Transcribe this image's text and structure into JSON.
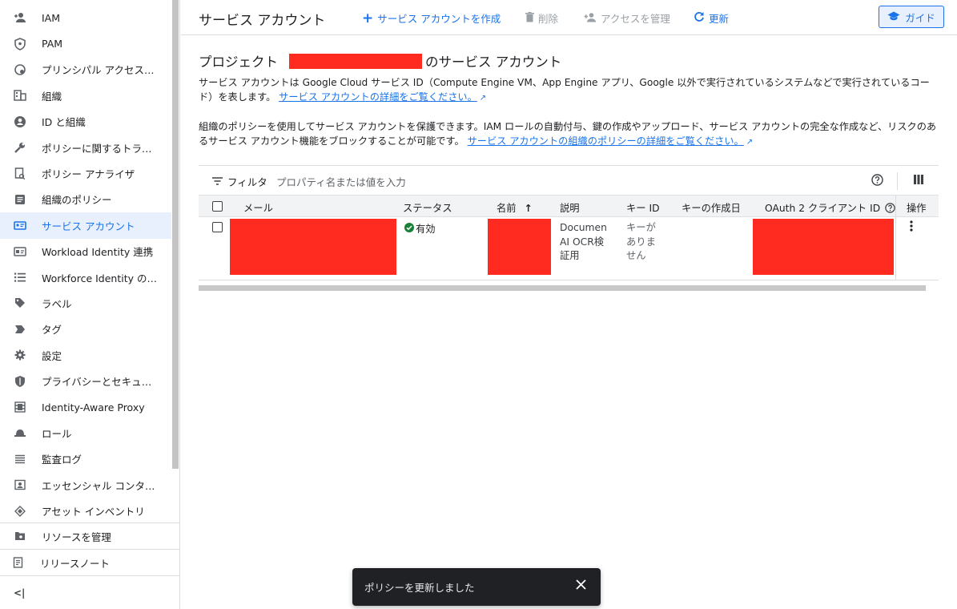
{
  "sidebar": {
    "items": [
      {
        "label": "IAM",
        "icon": "person-add-icon"
      },
      {
        "label": "PAM",
        "icon": "shield-icon"
      },
      {
        "label": "プリンシパル アクセス…",
        "icon": "principal-access-icon"
      },
      {
        "label": "組織",
        "icon": "building-icon"
      },
      {
        "label": "ID と組織",
        "icon": "account-circle-icon"
      },
      {
        "label": "ポリシーに関するトラ…",
        "icon": "wrench-icon"
      },
      {
        "label": "ポリシー アナライザ",
        "icon": "policy-analyzer-icon"
      },
      {
        "label": "組織のポリシー",
        "icon": "document-icon"
      },
      {
        "label": "サービス アカウント",
        "icon": "service-account-icon",
        "active": true
      },
      {
        "label": "Workload Identity 連携",
        "icon": "id-card-icon"
      },
      {
        "label": "Workforce Identity の連…",
        "icon": "list-icon"
      },
      {
        "label": "ラベル",
        "icon": "label-icon"
      },
      {
        "label": "タグ",
        "icon": "tag-icon"
      },
      {
        "label": "設定",
        "icon": "gear-icon"
      },
      {
        "label": "プライバシーとセキュ…",
        "icon": "privacy-shield-icon"
      },
      {
        "label": "Identity-Aware Proxy",
        "icon": "proxy-icon"
      },
      {
        "label": "ロール",
        "icon": "role-hat-icon"
      },
      {
        "label": "監査ログ",
        "icon": "lines-icon"
      },
      {
        "label": "エッセンシャル コンタ…",
        "icon": "contact-card-icon"
      },
      {
        "label": "アセット インベントリ",
        "icon": "inventory-icon"
      }
    ],
    "manage_resources": "リソースを管理",
    "release_notes": "リリースノート",
    "collapse_glyph": "<|"
  },
  "header": {
    "title": "サービス アカウント",
    "create_label": "サービス アカウントを作成",
    "delete_label": "削除",
    "manage_access_label": "アクセスを管理",
    "refresh_label": "更新",
    "guide_label": "ガイド"
  },
  "content": {
    "section_title_prefix": "プロジェクト",
    "section_title_suffix": "のサービス アカウント",
    "para1_text": "サービス アカウントは Google Cloud サービス ID（Compute Engine VM、App Engine アプリ、Google 以外で実行されているシステムなどで実行されているコード）を表します。",
    "para1_link": "サービス アカウントの詳細をご覧ください。",
    "para2_text": "組織のポリシーを使用してサービス アカウントを保護できます。IAM ロールの自動付与、鍵の作成やアップロード、サービス アカウントの完全な作成など、リスクのあるサービス アカウント機能をブロックすることが可能です。",
    "para2_link": "サービス アカウントの組織のポリシーの詳細をご覧ください。"
  },
  "filter": {
    "label": "フィルタ",
    "placeholder": "プロパティ名または値を入力"
  },
  "table": {
    "columns": {
      "email": "メール",
      "status": "ステータス",
      "name": "名前",
      "description": "説明",
      "key_id": "キー ID",
      "key_created": "キーの作成日",
      "oauth_client_id": "OAuth 2 クライアント ID",
      "actions": "操作"
    },
    "rows": [
      {
        "status": "有効",
        "description_lines": [
          "Documen",
          "AI OCR検",
          "証用"
        ],
        "key_id_lines": [
          "キーが",
          "ありま",
          "せん"
        ]
      }
    ]
  },
  "snackbar": {
    "message": "ポリシーを更新しました"
  },
  "colors": {
    "accent": "#1a73e8",
    "active_bg": "#e8f0fe",
    "redaction": "#ff2a20",
    "status_ok": "#188038"
  }
}
